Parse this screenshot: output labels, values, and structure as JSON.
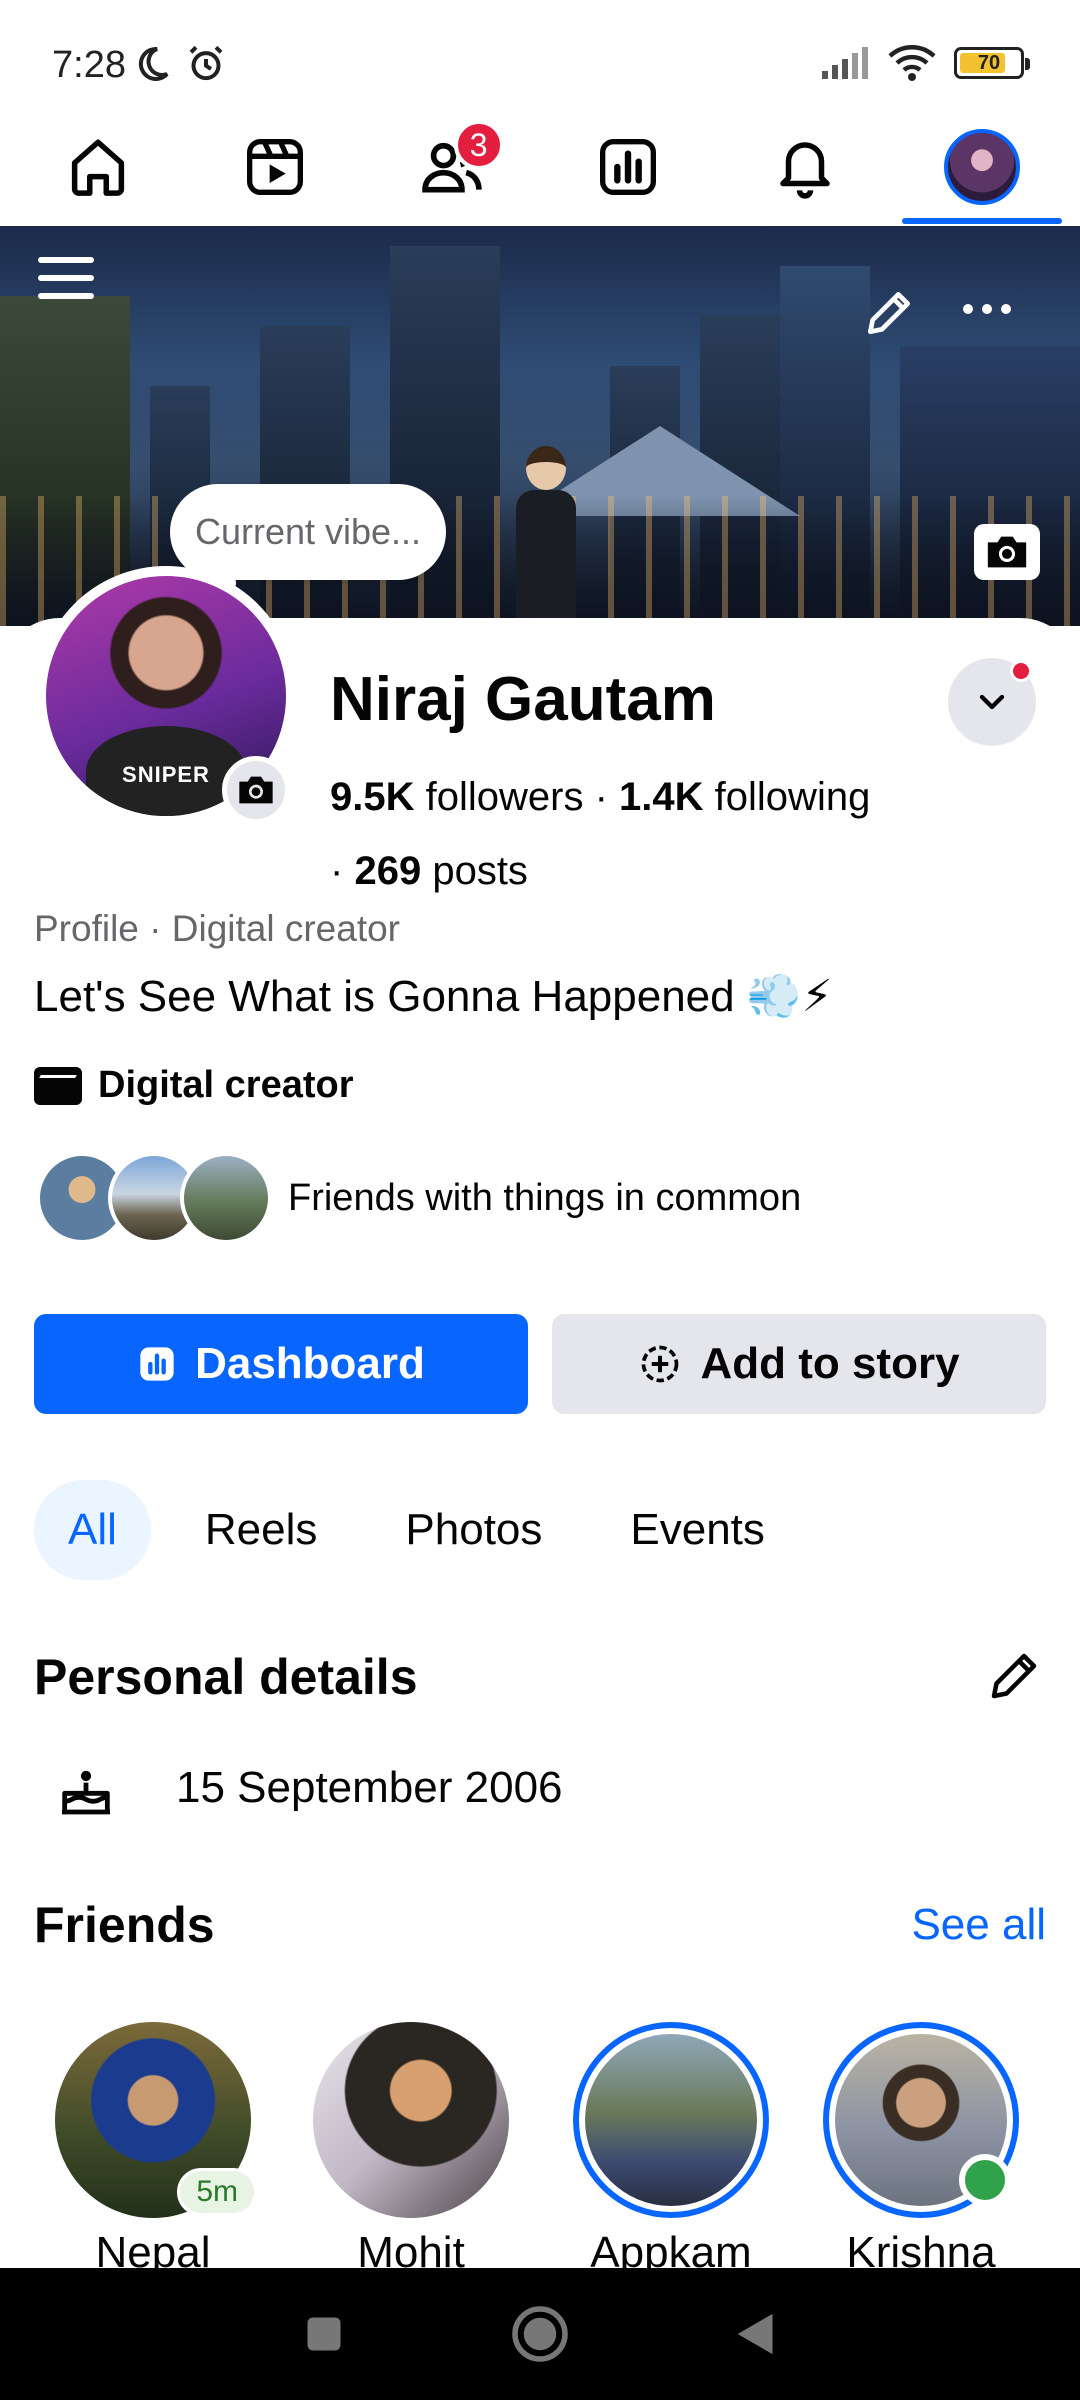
{
  "status_bar": {
    "time": "7:28",
    "battery": "70",
    "icons": [
      "moon-icon",
      "alarm-icon",
      "signal-icon",
      "wifi-icon",
      "battery-icon"
    ]
  },
  "top_nav": {
    "items": [
      "home-icon",
      "reels-icon",
      "friends-icon",
      "dashboard-icon",
      "notifications-icon",
      "profile-avatar"
    ],
    "friends_badge": "3",
    "active": "profile-avatar"
  },
  "cover": {
    "icons": [
      "menu-icon",
      "pencil-icon",
      "more-icon",
      "camera-icon"
    ]
  },
  "profile": {
    "vibe_placeholder": "Current vibe...",
    "avatar_text": "SNIPER",
    "name": "Niraj Gautam",
    "followers_count": "9.5K",
    "followers_label": "followers",
    "separator": "·",
    "following_count": "1.4K",
    "following_label": "following",
    "posts_count": "269",
    "posts_label": "posts",
    "meta": "Profile · Digital creator",
    "bio": "Let's See What is Gonna Happened 💨⚡",
    "category": "Digital creator",
    "mutuals_text": "Friends with things in common"
  },
  "actions": {
    "dashboard": "Dashboard",
    "add_story": "Add to story"
  },
  "tabs": [
    {
      "label": "All",
      "active": true
    },
    {
      "label": "Reels",
      "active": false
    },
    {
      "label": "Photos",
      "active": false
    },
    {
      "label": "Events",
      "active": false
    }
  ],
  "personal_details": {
    "title": "Personal details",
    "birthday": "15 September 2006"
  },
  "friends": {
    "title": "Friends",
    "see_all": "See all",
    "list": [
      {
        "name": "Nepal",
        "chip": "5m"
      },
      {
        "name": "Mohit"
      },
      {
        "name": "Appkam"
      },
      {
        "name": "Krishna"
      }
    ]
  },
  "colors": {
    "accent": "#0866ff",
    "badge": "#e41e3f",
    "online": "#31a24c"
  }
}
